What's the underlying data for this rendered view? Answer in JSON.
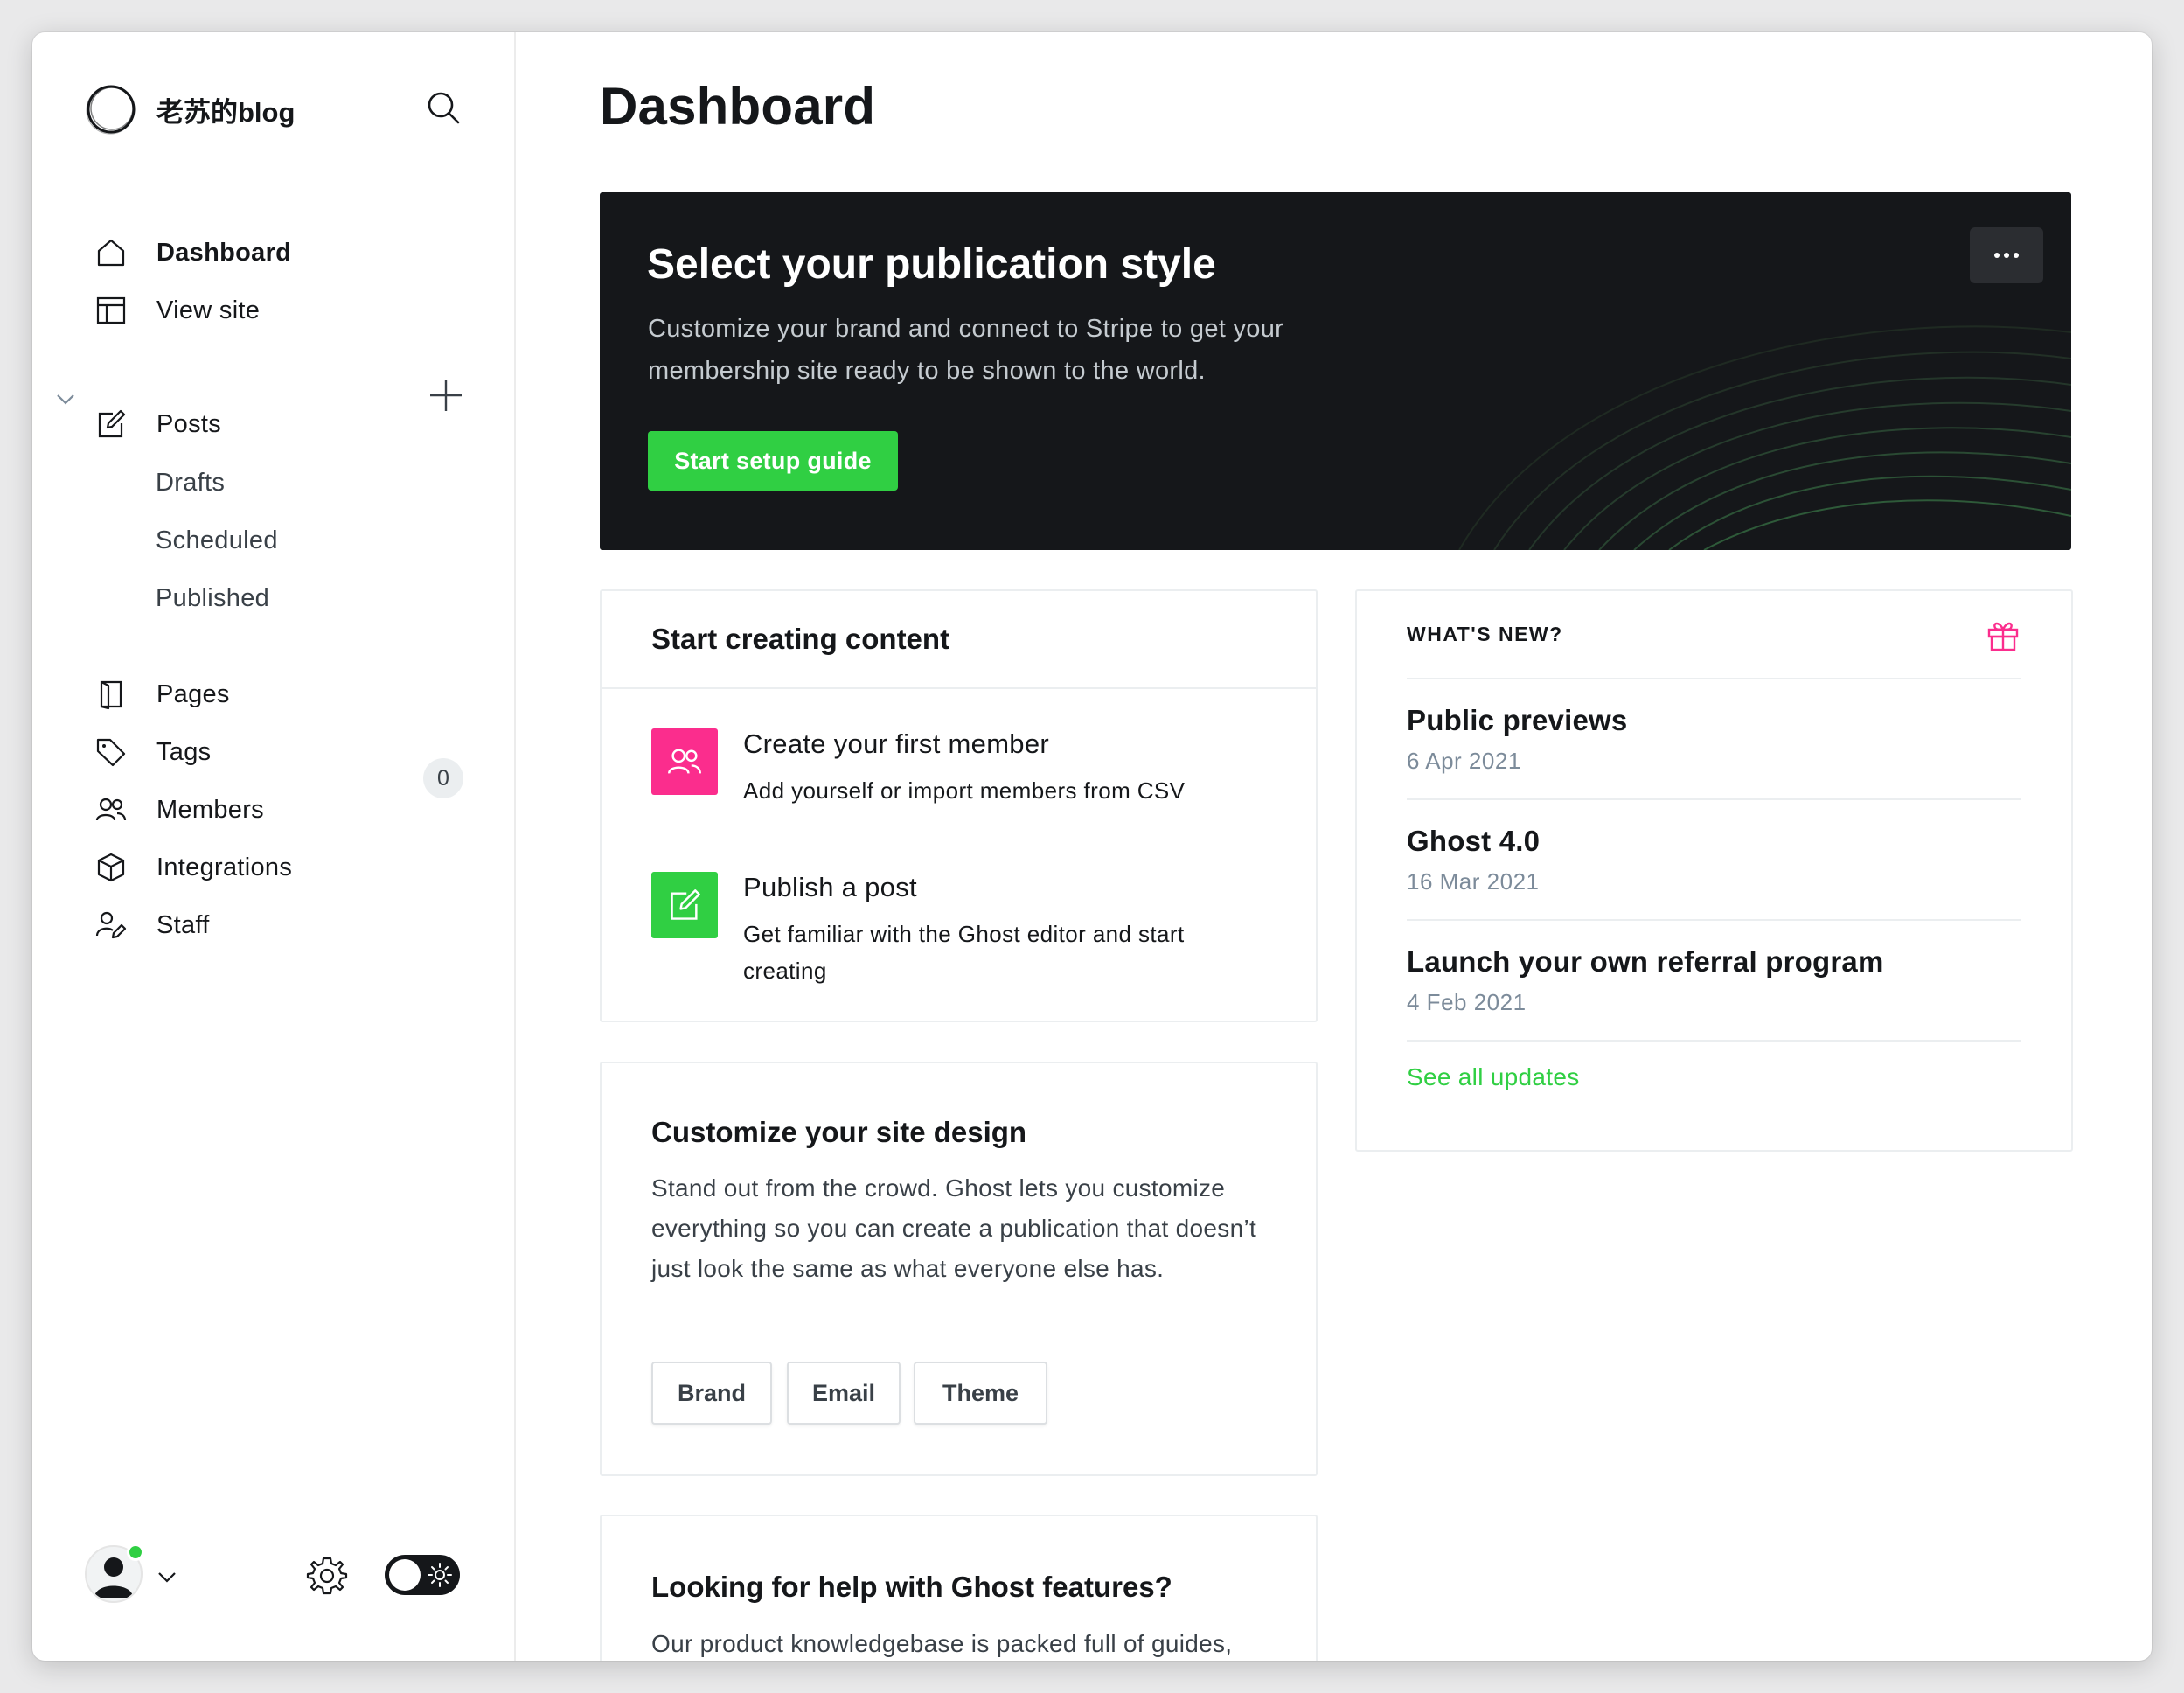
{
  "brand": {
    "name": "老苏的blog"
  },
  "nav": {
    "dashboard": "Dashboard",
    "view_site": "View site",
    "posts": "Posts",
    "drafts": "Drafts",
    "scheduled": "Scheduled",
    "published": "Published",
    "pages": "Pages",
    "tags": "Tags",
    "members": "Members",
    "members_count": "0",
    "integrations": "Integrations",
    "staff": "Staff"
  },
  "header": {
    "title": "Dashboard"
  },
  "banner": {
    "title": "Select your publication style",
    "description": "Customize your brand and connect to Stripe to get your membership site ready to be shown to the world.",
    "button": "Start setup guide"
  },
  "creating": {
    "title": "Start creating content",
    "tasks": [
      {
        "title": "Create your first member",
        "desc": "Add yourself or import members from CSV"
      },
      {
        "title": "Publish a post",
        "desc": "Get familiar with the Ghost editor and start creating"
      }
    ]
  },
  "design": {
    "title": "Customize your site design",
    "description": "Stand out from the crowd. Ghost lets you customize everything so you can create a publication that doesn’t just look the same as what everyone else has.",
    "buttons": [
      "Brand",
      "Email",
      "Theme"
    ]
  },
  "help": {
    "title": "Looking for help with Ghost features?",
    "description": "Our product knowledgebase is packed full of guides,"
  },
  "whats_new": {
    "label": "WHAT'S NEW?",
    "items": [
      {
        "title": "Public previews",
        "date": "6 Apr 2021"
      },
      {
        "title": "Ghost 4.0",
        "date": "16 Mar 2021"
      },
      {
        "title": "Launch your own referral program",
        "date": "4 Feb 2021"
      }
    ],
    "link": "See all updates"
  },
  "colors": {
    "accent_green": "#30cf43",
    "member_icon_bg": "#fb2d8d",
    "banner_bg": "#15171a",
    "gift_icon": "#fb2d8d"
  },
  "icons": {
    "brand": "brand-logo-icon",
    "search": "search-icon",
    "dashboard": "home-icon",
    "view_site": "layout-icon",
    "posts": "edit-icon",
    "pages": "page-icon",
    "tags": "tag-icon",
    "members": "members-icon",
    "integrations": "cube-icon",
    "staff": "staff-icon",
    "settings": "gear-icon",
    "theme_toggle": "sun-icon",
    "gift": "gift-icon"
  }
}
